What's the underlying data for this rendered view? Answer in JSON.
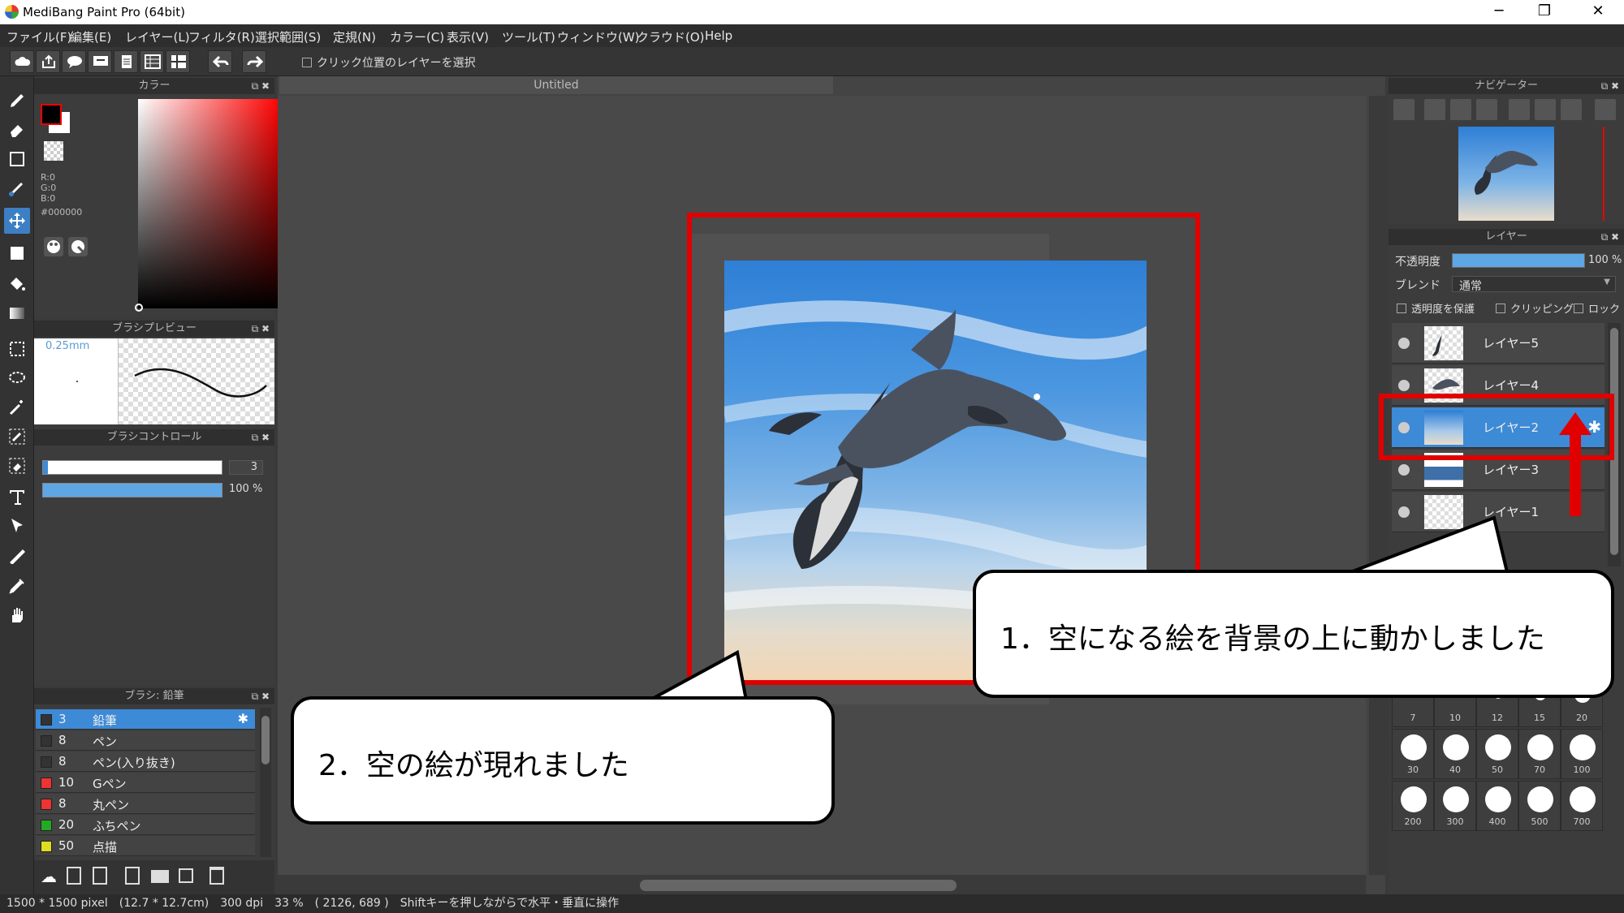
{
  "window": {
    "title": "MediBang Paint Pro (64bit)"
  },
  "menu": [
    "ファイル(F)",
    "編集(E)",
    "レイヤー(L)",
    "フィルタ(R)",
    "選択範囲(S)",
    "定規(N)",
    "カラー(C)",
    "表示(V)",
    "ツール(T)",
    "ウィンドウ(W)",
    "クラウド(O)",
    "Help"
  ],
  "toolbar": {
    "select_layer_on_click": "クリック位置のレイヤーを選択"
  },
  "color_panel": {
    "title": "カラー",
    "r": "R:0",
    "g": "G:0",
    "b": "B:0",
    "hex": "#000000",
    "fg_color": "#000000",
    "bg_color": "#ffffff"
  },
  "brush_preview": {
    "title": "ブラシプレビュー",
    "size_label": "0.25mm"
  },
  "brush_control": {
    "title": "ブラシコントロール",
    "size_value": "3",
    "opacity_value": "100 %"
  },
  "brush_list": {
    "title": "ブラシ: 鉛筆",
    "items": [
      {
        "size": "3",
        "name": "鉛筆",
        "color": "#333333",
        "selected": true
      },
      {
        "size": "8",
        "name": "ペン",
        "color": "#333333"
      },
      {
        "size": "8",
        "name": "ペン(入り抜き)",
        "color": "#333333"
      },
      {
        "size": "10",
        "name": "Gペン",
        "color": "#ee3333"
      },
      {
        "size": "8",
        "name": "丸ペン",
        "color": "#ee3333"
      },
      {
        "size": "20",
        "name": "ふちペン",
        "color": "#22aa22"
      },
      {
        "size": "50",
        "name": "点描",
        "color": "#dddd22"
      }
    ]
  },
  "document": {
    "tab_title": "Untitled"
  },
  "navigator": {
    "title": "ナビゲーター"
  },
  "layer_panel": {
    "title": "レイヤー",
    "opacity_label": "不透明度",
    "opacity_value": "100 %",
    "opacity_fraction": 1.0,
    "blend_label": "ブレンド",
    "blend_value": "通常",
    "protect_alpha": "透明度を保護",
    "clipping": "クリッピング",
    "lock": "ロック",
    "layers": [
      {
        "name": "レイヤー5",
        "selected": false
      },
      {
        "name": "レイヤー4",
        "selected": false
      },
      {
        "name": "レイヤー2",
        "selected": true
      },
      {
        "name": "レイヤー3",
        "selected": false
      },
      {
        "name": "レイヤー1",
        "selected": false
      }
    ]
  },
  "brush_sizes": {
    "row1": [
      "7",
      "10",
      "12",
      "15",
      "20"
    ],
    "row2": [
      "30",
      "40",
      "50",
      "70",
      "100"
    ],
    "row3": [
      "200",
      "300",
      "400",
      "500",
      "700"
    ]
  },
  "status": {
    "text": "1500 * 1500 pixel　(12.7 * 12.7cm)　300 dpi　33 %　( 2126, 689 )　Shiftキーを押しながらで水平・垂直に操作"
  },
  "annotations": {
    "callout1": "1．空になる絵を背景の上に動かしました",
    "callout2": "2．空の絵が現れました"
  }
}
